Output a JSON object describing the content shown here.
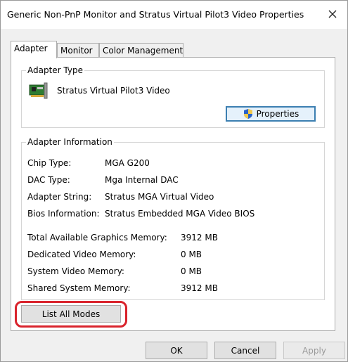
{
  "window": {
    "title": "Generic Non-PnP Monitor and Stratus Virtual Pilot3 Video Properties"
  },
  "tabs": [
    {
      "label": "Adapter",
      "active": true
    },
    {
      "label": "Monitor",
      "active": false
    },
    {
      "label": "Color Management",
      "active": false
    }
  ],
  "adapter_type": {
    "legend": "Adapter Type",
    "name": "Stratus Virtual Pilot3 Video",
    "properties_label": "Properties",
    "icons": [
      "graphics-card-icon",
      "uac-shield-icon"
    ]
  },
  "adapter_info": {
    "legend": "Adapter Information",
    "rows": [
      {
        "label": "Chip Type:",
        "value": "MGA G200"
      },
      {
        "label": "DAC Type:",
        "value": "Mga Internal DAC"
      },
      {
        "label": "Adapter String:",
        "value": "Stratus MGA Virtual Video"
      },
      {
        "label": "Bios Information:",
        "value": "Stratus Embedded MGA Video BIOS"
      }
    ],
    "memory": [
      {
        "label": "Total Available Graphics Memory:",
        "value": "3912 MB"
      },
      {
        "label": "Dedicated Video Memory:",
        "value": "0 MB"
      },
      {
        "label": "System Video Memory:",
        "value": "0 MB"
      },
      {
        "label": "Shared System Memory:",
        "value": "3912 MB"
      }
    ]
  },
  "list_all_modes_label": "List All Modes",
  "footer": {
    "ok_label": "OK",
    "cancel_label": "Cancel",
    "apply_label": "Apply"
  },
  "colors": {
    "highlight": "#d9232c",
    "default_button_border": "#3c7fb1"
  }
}
